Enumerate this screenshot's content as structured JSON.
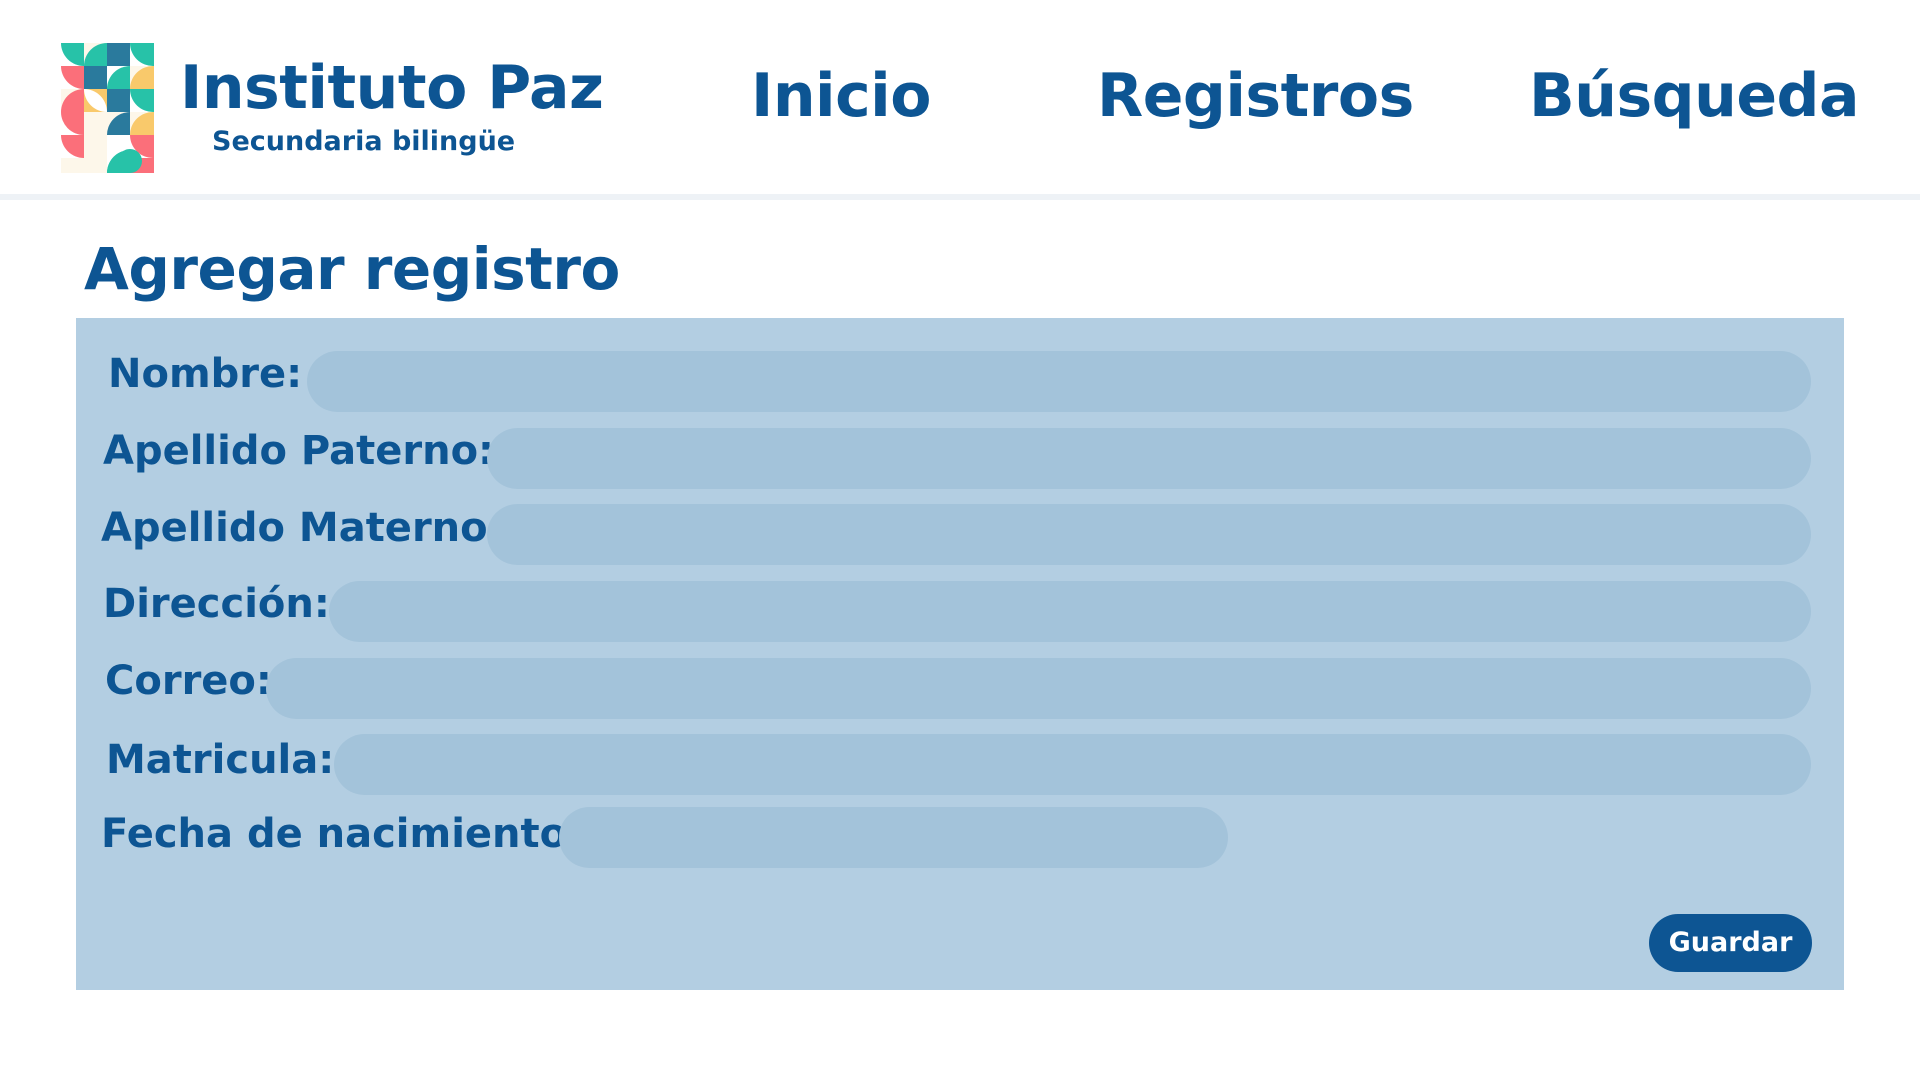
{
  "brand": {
    "name": "Instituto Paz",
    "subtitle": "Secundaria bilingüe"
  },
  "nav": {
    "items": [
      {
        "label": "Inicio"
      },
      {
        "label": "Registros"
      },
      {
        "label": "Búsqueda"
      }
    ]
  },
  "page": {
    "title": "Agregar registro"
  },
  "form": {
    "fields": [
      {
        "label": "Nombre:",
        "value": "",
        "placeholder": ""
      },
      {
        "label": "Apellido Paterno:",
        "value": "",
        "placeholder": ""
      },
      {
        "label": "Apellido Materno:",
        "value": "",
        "placeholder": ""
      },
      {
        "label": "Dirección:",
        "value": "",
        "placeholder": ""
      },
      {
        "label": "Correo:",
        "value": "",
        "placeholder": ""
      },
      {
        "label": "Matricula:",
        "value": "",
        "placeholder": ""
      },
      {
        "label": "Fecha de nacimiento:",
        "value": "",
        "placeholder": ""
      }
    ],
    "submit_label": "Guardar"
  },
  "colors": {
    "primary": "#0d5593",
    "panel": "#b3cee2",
    "input": "#a3c3da",
    "logo_teal": "#27c2a8",
    "logo_blue": "#2a7a9d",
    "logo_yellow": "#f9c96b",
    "logo_coral": "#fb6f7a"
  },
  "icons": {
    "logo": "geometric-mosaic-logo-icon"
  }
}
